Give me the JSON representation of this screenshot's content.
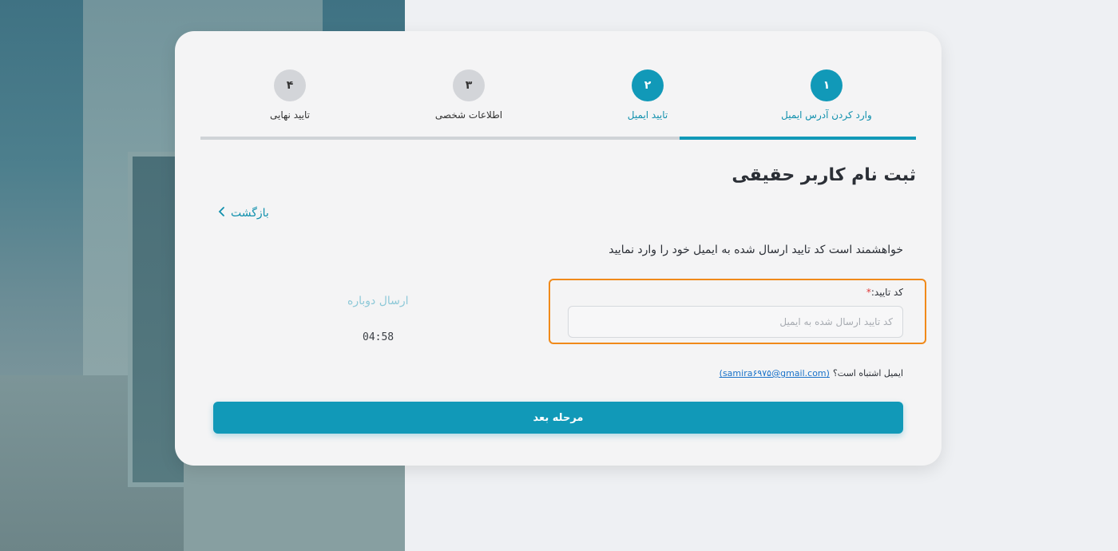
{
  "stepper": {
    "steps": [
      {
        "number": "۱",
        "label": "وارد کردن آدرس ایمیل",
        "state": "complete"
      },
      {
        "number": "۲",
        "label": "تایید ایمیل",
        "state": "active"
      },
      {
        "number": "۳",
        "label": "اطلاعات شخصی",
        "state": "pending"
      },
      {
        "number": "۴",
        "label": "تایید نهایی",
        "state": "pending"
      }
    ],
    "progress": 0.33
  },
  "page": {
    "title": "ثبت نام کاربر حقیقی",
    "back_label": "بازگشت",
    "instruction": "خواهشمند است کد تایید ارسال شده به ایمیل خود را وارد نمایید"
  },
  "code_field": {
    "label": "کد تایید:",
    "required_mark": "*",
    "value": "",
    "placeholder": "کد تایید ارسال شده به ایمیل"
  },
  "resend": {
    "label": "ارسال دوباره",
    "timer": "04:58"
  },
  "email_check": {
    "question": "ایمیل اشتباه است؟",
    "email": "(samira۶۹۷۵@gmail.com)"
  },
  "actions": {
    "next_label": "مرحله بعد"
  },
  "colors": {
    "accent": "#1199b8",
    "focus_border": "#f08a1a",
    "required": "#e03a3a",
    "link": "#1a72c9"
  }
}
